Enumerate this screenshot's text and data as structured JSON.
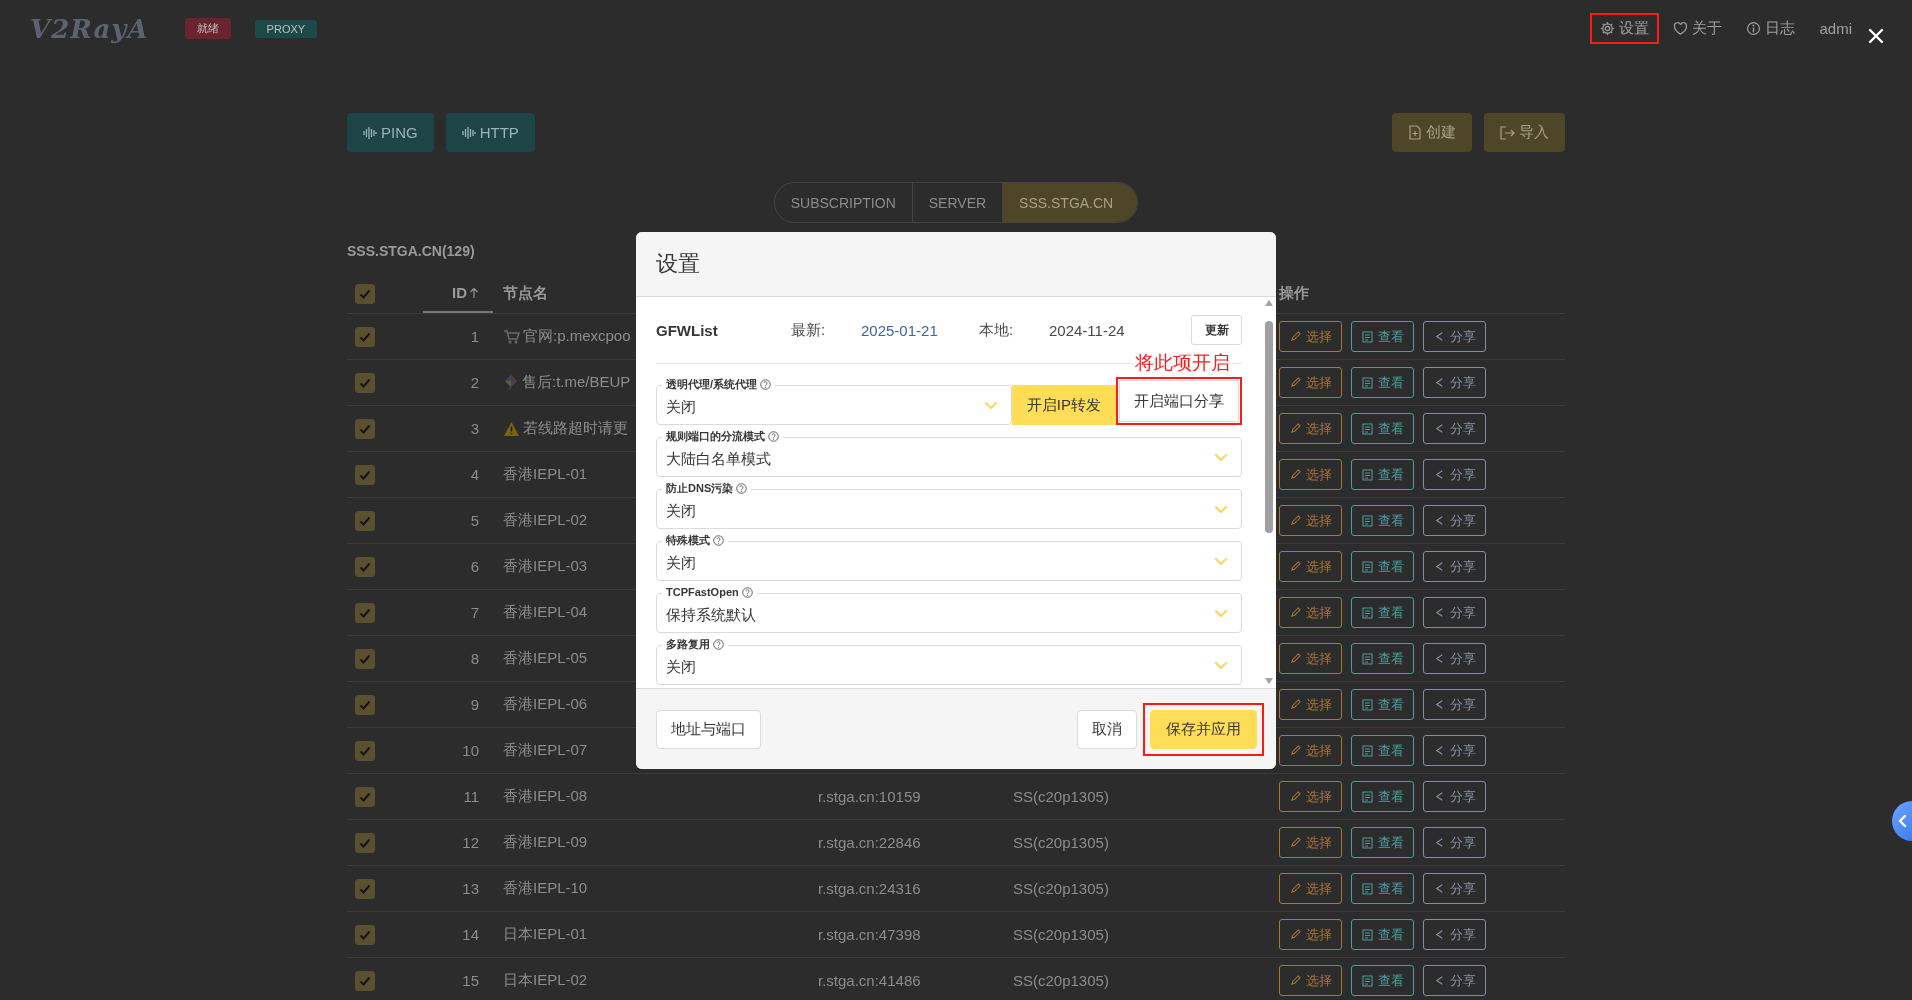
{
  "topbar": {
    "logo": "V2RayA",
    "badges": [
      {
        "label": "就绪",
        "color": "#6b2330"
      },
      {
        "label": "PROXY",
        "color": "#1c4a48"
      }
    ],
    "nav": [
      {
        "label": "设置",
        "highlighted": true
      },
      {
        "label": "关于",
        "highlighted": false
      },
      {
        "label": "日志",
        "highlighted": false
      },
      {
        "label": "admi",
        "highlighted": false
      }
    ]
  },
  "toolbar": {
    "left": [
      {
        "label": "PING"
      },
      {
        "label": "HTTP"
      }
    ],
    "right": [
      {
        "label": "创建"
      },
      {
        "label": "导入"
      }
    ]
  },
  "tabs": [
    {
      "label": "SUBSCRIPTION",
      "selected": false
    },
    {
      "label": "SERVER",
      "selected": false
    },
    {
      "label": "SSS.STGA.CN",
      "selected": true
    }
  ],
  "group_title": "SSS.STGA.CN(129)",
  "table": {
    "header_checked": true,
    "columns": [
      {
        "label": "ID",
        "kind": "id",
        "sorted": true
      },
      {
        "label": "节点名",
        "kind": "name",
        "sorted": false
      },
      {
        "label": "操作",
        "kind": "actions",
        "sorted": false
      }
    ],
    "rows": [
      {
        "checked": true,
        "id": "1",
        "has_icon": true,
        "name": "官网:p.mexcpoo",
        "actions": [
          {
            "label": "选择",
            "kind": "select"
          },
          {
            "label": "查看",
            "kind": "view"
          },
          {
            "label": "分享",
            "kind": "share"
          }
        ]
      },
      {
        "checked": true,
        "id": "2",
        "has_icon": true,
        "name": "售后:t.me/BEUP",
        "actions": [
          {
            "label": "选择",
            "kind": "select"
          },
          {
            "label": "查看",
            "kind": "view"
          },
          {
            "label": "分享",
            "kind": "share"
          }
        ]
      },
      {
        "checked": true,
        "id": "3",
        "has_icon": true,
        "name": "若线路超时请更",
        "actions": [
          {
            "label": "选择",
            "kind": "select"
          },
          {
            "label": "查看",
            "kind": "view"
          },
          {
            "label": "分享",
            "kind": "share"
          }
        ]
      },
      {
        "checked": true,
        "id": "4",
        "has_icon": false,
        "name": "香港IEPL-01",
        "actions": [
          {
            "label": "选择",
            "kind": "select"
          },
          {
            "label": "查看",
            "kind": "view"
          },
          {
            "label": "分享",
            "kind": "share"
          }
        ]
      },
      {
        "checked": true,
        "id": "5",
        "has_icon": false,
        "name": "香港IEPL-02",
        "actions": [
          {
            "label": "选择",
            "kind": "select"
          },
          {
            "label": "查看",
            "kind": "view"
          },
          {
            "label": "分享",
            "kind": "share"
          }
        ]
      },
      {
        "checked": true,
        "id": "6",
        "has_icon": false,
        "name": "香港IEPL-03",
        "actions": [
          {
            "label": "选择",
            "kind": "select"
          },
          {
            "label": "查看",
            "kind": "view"
          },
          {
            "label": "分享",
            "kind": "share"
          }
        ]
      },
      {
        "checked": true,
        "id": "7",
        "has_icon": false,
        "name": "香港IEPL-04",
        "actions": [
          {
            "label": "选择",
            "kind": "select"
          },
          {
            "label": "查看",
            "kind": "view"
          },
          {
            "label": "分享",
            "kind": "share"
          }
        ]
      },
      {
        "checked": true,
        "id": "8",
        "has_icon": false,
        "name": "香港IEPL-05",
        "actions": [
          {
            "label": "选择",
            "kind": "select"
          },
          {
            "label": "查看",
            "kind": "view"
          },
          {
            "label": "分享",
            "kind": "share"
          }
        ]
      },
      {
        "checked": true,
        "id": "9",
        "has_icon": false,
        "name": "香港IEPL-06",
        "actions": [
          {
            "label": "选择",
            "kind": "select"
          },
          {
            "label": "查看",
            "kind": "view"
          },
          {
            "label": "分享",
            "kind": "share"
          }
        ]
      },
      {
        "checked": true,
        "id": "10",
        "has_icon": false,
        "name": "香港IEPL-07",
        "actions": [
          {
            "label": "选择",
            "kind": "select"
          },
          {
            "label": "查看",
            "kind": "view"
          },
          {
            "label": "分享",
            "kind": "share"
          }
        ]
      },
      {
        "checked": true,
        "id": "11",
        "has_icon": false,
        "name": "香港IEPL-08",
        "address": "r.stga.cn:10159",
        "protocol": "SS(c20p1305)",
        "actions": [
          {
            "label": "选择",
            "kind": "select"
          },
          {
            "label": "查看",
            "kind": "view"
          },
          {
            "label": "分享",
            "kind": "share"
          }
        ]
      },
      {
        "checked": true,
        "id": "12",
        "has_icon": false,
        "name": "香港IEPL-09",
        "address": "r.stga.cn:22846",
        "protocol": "SS(c20p1305)",
        "actions": [
          {
            "label": "选择",
            "kind": "select"
          },
          {
            "label": "查看",
            "kind": "view"
          },
          {
            "label": "分享",
            "kind": "share"
          }
        ]
      },
      {
        "checked": true,
        "id": "13",
        "has_icon": false,
        "name": "香港IEPL-10",
        "address": "r.stga.cn:24316",
        "protocol": "SS(c20p1305)",
        "actions": [
          {
            "label": "选择",
            "kind": "select"
          },
          {
            "label": "查看",
            "kind": "view"
          },
          {
            "label": "分享",
            "kind": "share"
          }
        ]
      },
      {
        "checked": true,
        "id": "14",
        "has_icon": false,
        "name": "日本IEPL-01",
        "address": "r.stga.cn:47398",
        "protocol": "SS(c20p1305)",
        "actions": [
          {
            "label": "选择",
            "kind": "select"
          },
          {
            "label": "查看",
            "kind": "view"
          },
          {
            "label": "分享",
            "kind": "share"
          }
        ]
      },
      {
        "checked": true,
        "id": "15",
        "has_icon": false,
        "name": "日本IEPL-02",
        "address": "r.stga.cn:41486",
        "protocol": "SS(c20p1305)",
        "actions": [
          {
            "label": "选择",
            "kind": "select"
          },
          {
            "label": "查看",
            "kind": "view"
          },
          {
            "label": "分享",
            "kind": "share"
          }
        ]
      }
    ]
  },
  "modal": {
    "title": "设置",
    "gfwlist": {
      "name": "GFWList",
      "latest_label": "最新:",
      "latest": "2025-01-21",
      "local_label": "本地:",
      "local": "2024-11-24",
      "update_button": "更新"
    },
    "note": "将此项开启",
    "fields": [
      {
        "label": "透明代理/系统代理",
        "value": "关闭",
        "buttons": [
          {
            "label": "开启IP转发",
            "active": true,
            "highlighted": false
          },
          {
            "label": "开启端口分享",
            "active": false,
            "highlighted": true
          }
        ]
      },
      {
        "label": "规则端口的分流模式",
        "value": "大陆白名单模式"
      },
      {
        "label": "防止DNS污染",
        "value": "关闭"
      },
      {
        "label": "特殊模式",
        "value": "关闭"
      },
      {
        "label": "TCPFastOpen",
        "value": "保持系统默认"
      },
      {
        "label": "多路复用",
        "value": "关闭"
      }
    ],
    "footer": [
      {
        "label": "地址与端口",
        "kind": "plain",
        "highlighted": false
      },
      {
        "label": "取消",
        "kind": "plain",
        "highlighted": false
      },
      {
        "label": "保存并应用",
        "kind": "primary",
        "highlighted": true
      }
    ]
  }
}
